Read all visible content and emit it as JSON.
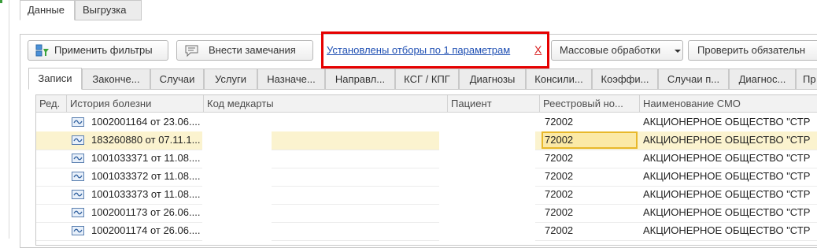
{
  "outer_tabs": [
    "Данные",
    "Выгрузка"
  ],
  "toolbar": {
    "apply_filters": "Применить фильтры",
    "add_remarks": "Внести замечания",
    "filter_status": "Установлены отборы по 1 параметрам",
    "clear_filter": "Х",
    "mass_processing": "Массовые обработки",
    "check_required": "Проверить обязательн"
  },
  "inner_tabs": [
    "Записи",
    "Законче...",
    "Случаи",
    "Услуги",
    "Назначе...",
    "Направл...",
    "КСГ / КПГ",
    "Диагнозы",
    "Консили...",
    "Коэффи...",
    "Случаи п...",
    "Диагнос...",
    "Пр"
  ],
  "columns": [
    "Ред.",
    "История болезни",
    "Код медкарты",
    "Пациент",
    "Реестровый но...",
    "Наименование СМО"
  ],
  "rows": [
    {
      "history": "1002001164 от 23.06....",
      "registry": "72002",
      "smo": "АКЦИОНЕРНОЕ ОБЩЕСТВО \"СТР"
    },
    {
      "history": "183260880 от 07.11.1...",
      "registry": "72002",
      "smo": "АКЦИОНЕРНОЕ ОБЩЕСТВО \"СТР"
    },
    {
      "history": "1001033371 от 11.08....",
      "registry": "72002",
      "smo": "АКЦИОНЕРНОЕ ОБЩЕСТВО \"СТР"
    },
    {
      "history": "1001033372 от 11.08....",
      "registry": "72002",
      "smo": "АКЦИОНЕРНОЕ ОБЩЕСТВО \"СТР"
    },
    {
      "history": "1001033373 от 11.08....",
      "registry": "72002",
      "smo": "АКЦИОНЕРНОЕ ОБЩЕСТВО \"СТР"
    },
    {
      "history": "1002001173 от 26.06....",
      "registry": "72002",
      "smo": "АКЦИОНЕРНОЕ ОБЩЕСТВО \"СТР"
    },
    {
      "history": "1002001174 от 26.06....",
      "registry": "72002",
      "smo": "АКЦИОНЕРНОЕ ОБЩЕСТВО \"СТР"
    }
  ],
  "selected_row": 1,
  "icons": {
    "apply_filters": "filter-apply-icon",
    "add_remarks": "comment-icon",
    "row": "record-icon"
  },
  "colors": {
    "highlight_border": "#e60000",
    "link": "#1f4fb3",
    "selection": "#fbf3cf",
    "current_cell_border": "#e8b82a"
  }
}
